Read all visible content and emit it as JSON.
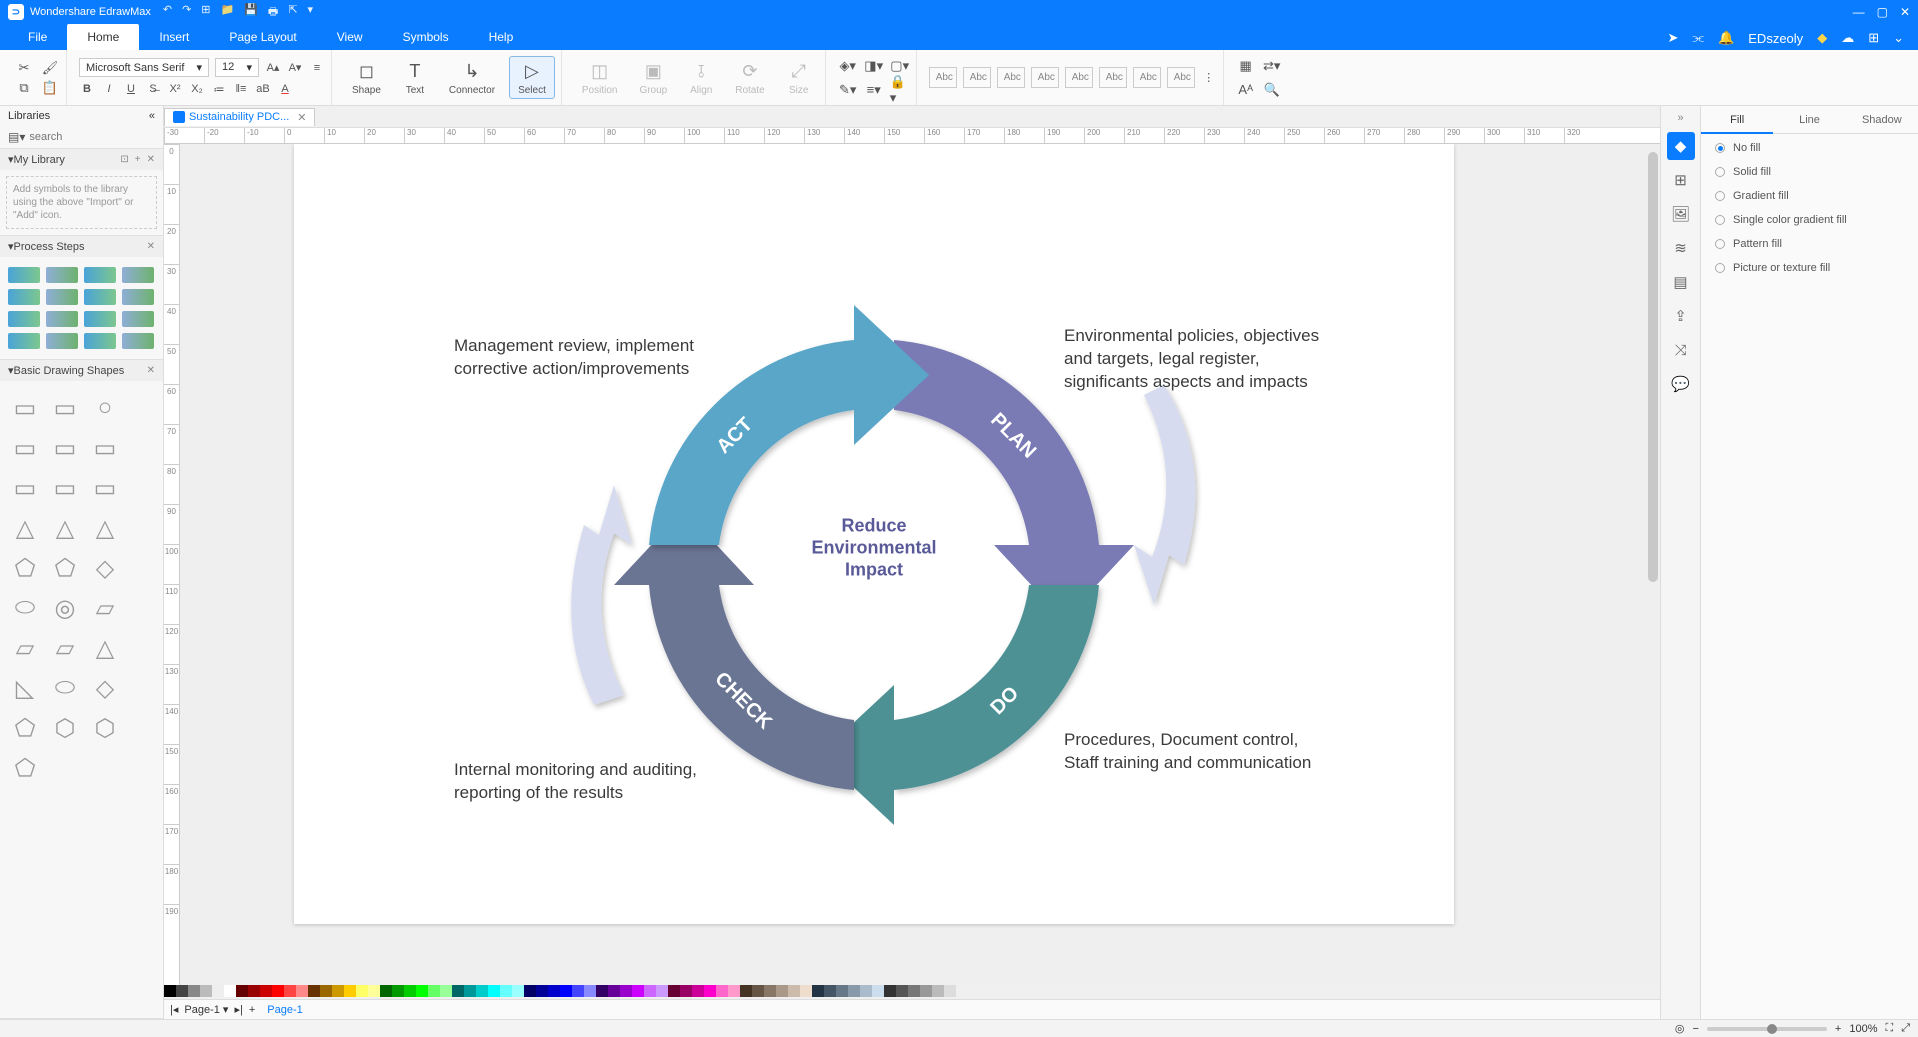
{
  "app": {
    "title": "Wondershare EdrawMax"
  },
  "user": "EDszeoly",
  "menu": {
    "file": "File",
    "home": "Home",
    "insert": "Insert",
    "pagelayout": "Page Layout",
    "view": "View",
    "symbols": "Symbols",
    "help": "Help"
  },
  "ribbon": {
    "font": "Microsoft Sans Serif",
    "size": "12",
    "shape": "Shape",
    "text": "Text",
    "connector": "Connector",
    "select": "Select",
    "position": "Position",
    "group": "Group",
    "align": "Align",
    "rotate": "Rotate",
    "sizel": "Size",
    "abc": "Abc"
  },
  "left": {
    "title": "Libraries",
    "search_ph": "search",
    "mylib": "My Library",
    "hint": "Add symbols to the library using the above \"Import\" or \"Add\" icon.",
    "process": "Process Steps",
    "basic": "Basic Drawing Shapes"
  },
  "doc": {
    "tab": "Sustainability PDC...",
    "page": "Page-1"
  },
  "right": {
    "fill": "Fill",
    "line": "Line",
    "shadow": "Shadow",
    "nofill": "No fill",
    "solid": "Solid fill",
    "gradient": "Gradient fill",
    "single": "Single color gradient fill",
    "pattern": "Pattern fill",
    "picture": "Picture or texture fill"
  },
  "status": {
    "page": "Page-1",
    "pagebtn": "Page-1",
    "zoom": "100%"
  },
  "diagram": {
    "center": "Reduce Environmental Impact",
    "plan": "PLAN",
    "do": "DO",
    "check": "CHECK",
    "act": "ACT",
    "tl": "Management review, implement corrective action/improvements",
    "tr": "Environmental policies, objectives and targets, legal register, significants aspects and impacts",
    "bl": "Internal monitoring and auditing, reporting of the results",
    "br": "Procedures, Document control, Staff training and communication"
  },
  "ruler_h": [
    "-30",
    "-20",
    "-10",
    "0",
    "10",
    "20",
    "30",
    "40",
    "50",
    "60",
    "70",
    "80",
    "90",
    "100",
    "110",
    "120",
    "130",
    "140",
    "150",
    "160",
    "170",
    "180",
    "190",
    "200",
    "210",
    "220",
    "230",
    "240",
    "250",
    "260",
    "270",
    "280",
    "290",
    "300",
    "310",
    "320"
  ],
  "ruler_v": [
    "0",
    "10",
    "20",
    "30",
    "40",
    "50",
    "60",
    "70",
    "80",
    "90",
    "100",
    "110",
    "120",
    "130",
    "140",
    "150",
    "160",
    "170",
    "180",
    "190"
  ],
  "palette": [
    "#000",
    "#444",
    "#888",
    "#bbb",
    "#eee",
    "#fff",
    "#600",
    "#900",
    "#c00",
    "#f00",
    "#f44",
    "#f88",
    "#630",
    "#960",
    "#c90",
    "#fc0",
    "#ff6",
    "#ff9",
    "#060",
    "#090",
    "#0c0",
    "#0f0",
    "#6f6",
    "#9f9",
    "#066",
    "#099",
    "#0cc",
    "#0ff",
    "#6ff",
    "#9ff",
    "#006",
    "#009",
    "#00c",
    "#00f",
    "#44f",
    "#88f",
    "#306",
    "#609",
    "#90c",
    "#c0f",
    "#c6f",
    "#c9f",
    "#603",
    "#906",
    "#c09",
    "#f0c",
    "#f6c",
    "#f9c",
    "#432",
    "#654",
    "#876",
    "#a98",
    "#cba",
    "#edc",
    "#234",
    "#456",
    "#678",
    "#89a",
    "#abc",
    "#cde",
    "#333",
    "#555",
    "#777",
    "#999",
    "#bbb",
    "#ddd"
  ]
}
